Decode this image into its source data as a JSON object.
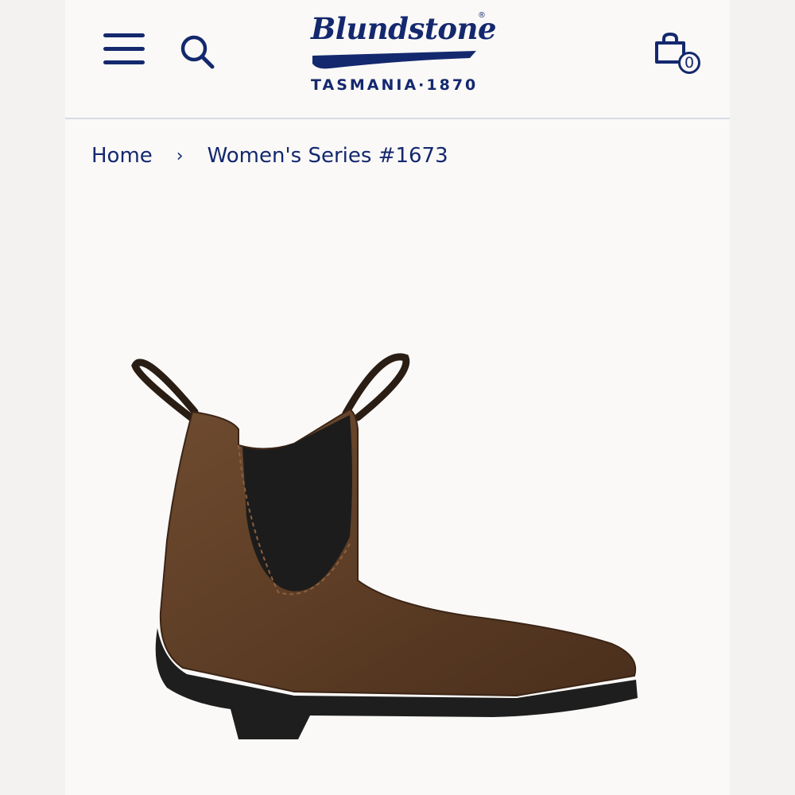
{
  "header": {
    "logo": {
      "wordmark": "Blundstone",
      "registered": "®",
      "tagline": "TASMANIA·1870"
    },
    "menu_icon": "hamburger-menu-icon",
    "search_icon": "search-icon",
    "cart": {
      "icon": "shopping-bag-icon",
      "count": "0"
    }
  },
  "breadcrumb": {
    "home": "Home",
    "separator": "›",
    "current": "Women's Series #1673"
  },
  "product": {
    "image": "brown-leather-chelsea-boot"
  },
  "colors": {
    "brand": "#14286e",
    "background": "#faf9f7",
    "divider": "#d6dbe6"
  }
}
